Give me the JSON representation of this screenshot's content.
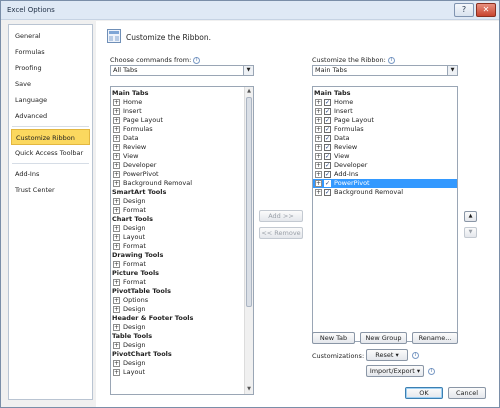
{
  "window": {
    "title": "Excel Options"
  },
  "titlebar_buttons": {
    "help": "?",
    "close": "✕"
  },
  "nav": {
    "items": [
      {
        "label": "General",
        "selected": false
      },
      {
        "label": "Formulas",
        "selected": false
      },
      {
        "label": "Proofing",
        "selected": false
      },
      {
        "label": "Save",
        "selected": false
      },
      {
        "label": "Language",
        "selected": false
      },
      {
        "label": "Advanced",
        "selected": false
      },
      {
        "label": "Customize Ribbon",
        "selected": true
      },
      {
        "label": "Quick Access Toolbar",
        "selected": false
      },
      {
        "label": "Add-Ins",
        "selected": false
      },
      {
        "label": "Trust Center",
        "selected": false
      }
    ]
  },
  "header": {
    "text": "Customize the Ribbon."
  },
  "left": {
    "label": "Choose commands from:",
    "combo_value": "All Tabs",
    "rows": [
      {
        "kind": "header",
        "label": "Main Tabs"
      },
      {
        "kind": "item",
        "label": "Home"
      },
      {
        "kind": "item",
        "label": "Insert"
      },
      {
        "kind": "item",
        "label": "Page Layout"
      },
      {
        "kind": "item",
        "label": "Formulas"
      },
      {
        "kind": "item",
        "label": "Data"
      },
      {
        "kind": "item",
        "label": "Review"
      },
      {
        "kind": "item",
        "label": "View"
      },
      {
        "kind": "item",
        "label": "Developer"
      },
      {
        "kind": "item",
        "label": "PowerPivot"
      },
      {
        "kind": "item",
        "label": "Background Removal"
      },
      {
        "kind": "header",
        "label": "SmartArt Tools"
      },
      {
        "kind": "item",
        "label": "Design"
      },
      {
        "kind": "item",
        "label": "Format"
      },
      {
        "kind": "header",
        "label": "Chart Tools"
      },
      {
        "kind": "item",
        "label": "Design"
      },
      {
        "kind": "item",
        "label": "Layout"
      },
      {
        "kind": "item",
        "label": "Format"
      },
      {
        "kind": "header",
        "label": "Drawing Tools"
      },
      {
        "kind": "item",
        "label": "Format"
      },
      {
        "kind": "header",
        "label": "Picture Tools"
      },
      {
        "kind": "item",
        "label": "Format"
      },
      {
        "kind": "header",
        "label": "PivotTable Tools"
      },
      {
        "kind": "item",
        "label": "Options"
      },
      {
        "kind": "item",
        "label": "Design"
      },
      {
        "kind": "header",
        "label": "Header & Footer Tools"
      },
      {
        "kind": "item",
        "label": "Design"
      },
      {
        "kind": "header",
        "label": "Table Tools"
      },
      {
        "kind": "item",
        "label": "Design"
      },
      {
        "kind": "header",
        "label": "PivotChart Tools"
      },
      {
        "kind": "item",
        "label": "Design"
      },
      {
        "kind": "item",
        "label": "Layout"
      }
    ]
  },
  "middle": {
    "add": "Add >>",
    "remove": "<< Remove"
  },
  "right": {
    "label": "Customize the Ribbon:",
    "combo_value": "Main Tabs",
    "header": "Main Tabs",
    "items": [
      {
        "label": "Home",
        "checked": true,
        "selected": false
      },
      {
        "label": "Insert",
        "checked": true,
        "selected": false
      },
      {
        "label": "Page Layout",
        "checked": true,
        "selected": false
      },
      {
        "label": "Formulas",
        "checked": true,
        "selected": false
      },
      {
        "label": "Data",
        "checked": true,
        "selected": false
      },
      {
        "label": "Review",
        "checked": true,
        "selected": false
      },
      {
        "label": "View",
        "checked": true,
        "selected": false
      },
      {
        "label": "Developer",
        "checked": true,
        "selected": false
      },
      {
        "label": "Add-Ins",
        "checked": true,
        "selected": false
      },
      {
        "label": "PowerPivot",
        "checked": true,
        "selected": true
      },
      {
        "label": "Background Removal",
        "checked": true,
        "selected": false
      }
    ],
    "new_tab": "New Tab",
    "new_group": "New Group",
    "rename": "Rename...",
    "customizations_label": "Customizations:",
    "reset": "Reset ▾",
    "import_export": "Import/Export ▾"
  },
  "move": {
    "up": "▲",
    "down": "▼"
  },
  "footer": {
    "ok": "OK",
    "cancel": "Cancel"
  },
  "glyphs": {
    "expand": "+",
    "check": "✓",
    "info": "i",
    "dropdown": "▼",
    "scroll_up": "▲",
    "scroll_down": "▼"
  },
  "colors": {
    "selection": "#3399ff",
    "nav_highlight": "#fbd85f"
  }
}
